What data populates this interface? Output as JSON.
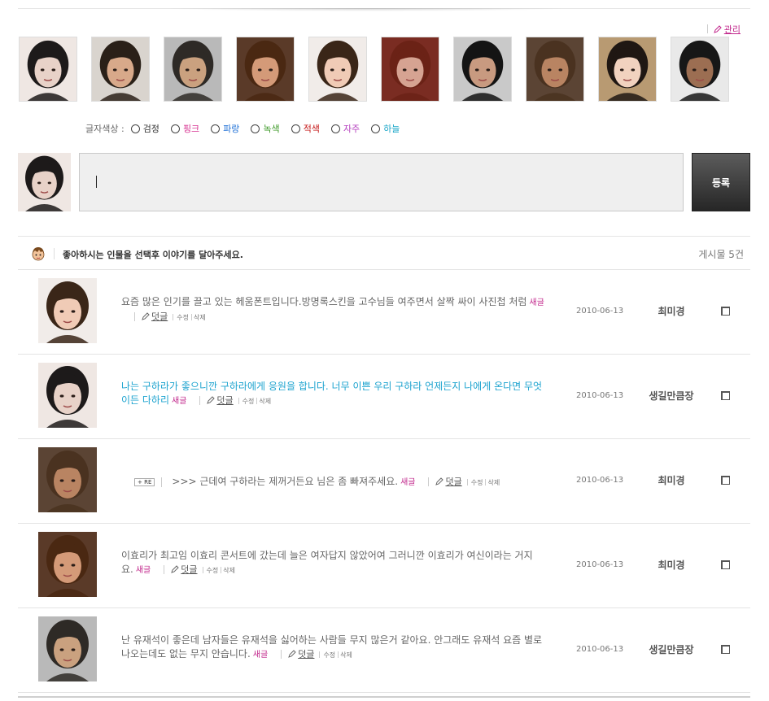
{
  "admin": {
    "label": "관리"
  },
  "avatars": [
    {
      "name": "avatar-1",
      "skin": "#e8d2c8",
      "hair": "#1d1a1a",
      "bg": "#efe7e3"
    },
    {
      "name": "avatar-2",
      "skin": "#d8a98a",
      "hair": "#2a2018",
      "bg": "#d9d4ce"
    },
    {
      "name": "avatar-3",
      "skin": "#caa17f",
      "hair": "#2e2a26",
      "bg": "#b9b9b9"
    },
    {
      "name": "avatar-4",
      "skin": "#d49a78",
      "hair": "#4a2812",
      "bg": "#5a3a28"
    },
    {
      "name": "avatar-5",
      "skin": "#f0cbb6",
      "hair": "#3a2618",
      "bg": "#f1ece9"
    },
    {
      "name": "avatar-6",
      "skin": "#d6a392",
      "hair": "#6b2216",
      "bg": "#7a2c22"
    },
    {
      "name": "avatar-7",
      "skin": "#c89a80",
      "hair": "#141414",
      "bg": "#c9c9c9"
    },
    {
      "name": "avatar-8",
      "skin": "#b98462",
      "hair": "#4a3220",
      "bg": "#5b4434"
    },
    {
      "name": "avatar-9",
      "skin": "#f1d2bf",
      "hair": "#1f1713",
      "bg": "#b89a72"
    },
    {
      "name": "avatar-10",
      "skin": "#9c6e52",
      "hair": "#171717",
      "bg": "#e9e9e9"
    }
  ],
  "color_picker": {
    "label": "글자색상 :",
    "options": [
      {
        "label": "검정",
        "color": "#333333"
      },
      {
        "label": "핑크",
        "color": "#d62c8e"
      },
      {
        "label": "파랑",
        "color": "#1d6fd6"
      },
      {
        "label": "녹색",
        "color": "#3f9a2a"
      },
      {
        "label": "적색",
        "color": "#c41414"
      },
      {
        "label": "자주",
        "color": "#b53fbf"
      },
      {
        "label": "하늘",
        "color": "#1aa6c8"
      }
    ]
  },
  "composer": {
    "submit_label": "등록"
  },
  "list": {
    "guide": "좋아하시는 인물을 선택후 이야기를 달아주세요.",
    "count": "게시물 5건"
  },
  "actions": {
    "new": "새글",
    "reply": "덧글",
    "edit": "수정",
    "delete": "삭제",
    "re": "RE"
  },
  "posts": [
    {
      "text": "요즘 많은 인기를 끌고 있는 헤움폰트입니다.방명록스킨을 고수님들 여주면서 살짝 싸이 사진첩 처럼",
      "date": "2010-06-13",
      "author": "최미경",
      "style": "gray",
      "photo": 4
    },
    {
      "text": "나는 구하라가 좋으니깐 구하라에게 응원을 합니다. 너무 이쁜 우리 구하라 언제든지 나에게 온다면 무엇이든 다하리",
      "date": "2010-06-13",
      "author": "생길만큼장",
      "style": "blue",
      "photo": 0
    },
    {
      "text": ">>> 근데여 구하라는 제꺼거든요 님은 좀 빠져주세요.",
      "date": "2010-06-13",
      "author": "최미경",
      "style": "reply",
      "photo": 7
    },
    {
      "text": "이효리가 최고임 이효리 콘서트에 갔는데 늘은 여자답지 않았어여 그러니깐 이효리가 여신이라는 거지요.",
      "date": "2010-06-13",
      "author": "최미경",
      "style": "gray",
      "photo": 3
    },
    {
      "text": "난 유재석이 좋은데 남자들은 유재석을 싫어하는 사람들 무지 많은거 같아요. 안그래도 유재석 요즘 별로 나오는데도 없는 무지 안습니다.",
      "date": "2010-06-13",
      "author": "생길만큼장",
      "style": "gray",
      "photo": 2
    }
  ]
}
